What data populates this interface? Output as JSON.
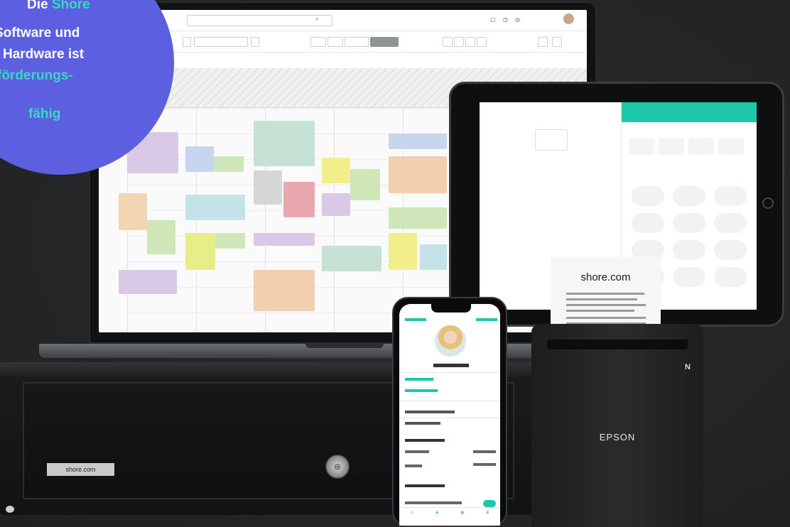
{
  "badge": {
    "line1_a": "Die ",
    "line1_b": "Shore",
    "line2": "Software und",
    "line3": "Hardware ist",
    "line4": "förderungs-",
    "line5": "fähig"
  },
  "devices": {
    "printer_brand": "EPSON",
    "receipt_title": "shore.com",
    "drawer_label": "shore.com"
  },
  "colors": {
    "badge": "#5b5fe0",
    "highlight": "#38d9c0",
    "accent": "#1fc7a9",
    "background": "#252729"
  }
}
